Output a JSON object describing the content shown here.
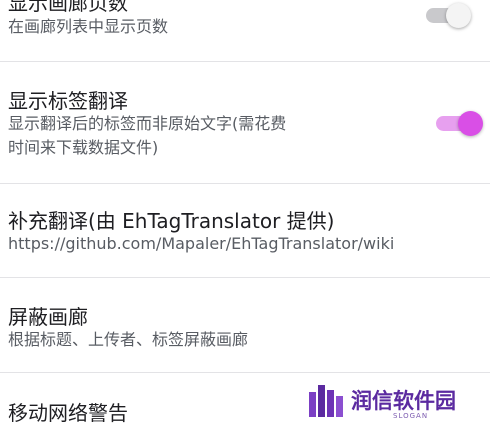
{
  "colors": {
    "accent": "#d94fe6",
    "accent_track": "#e7a0ef",
    "switch_off_track": "#c9c9cc",
    "divider": "#e3e3e6",
    "brand": "#5b2aa0"
  },
  "settings": [
    {
      "title": "显示画廊页数",
      "desc_lines": [
        "在画廊列表中显示页数"
      ],
      "toggle": {
        "on": false
      }
    },
    {
      "title": "显示标签翻译",
      "desc_lines": [
        "显示翻译后的标签而非原始文字(需花费",
        "时间来下载数据文件)"
      ],
      "toggle": {
        "on": true
      }
    },
    {
      "title": "补充翻译(由 EhTagTranslator 提供)",
      "desc_lines": [
        "https://github.com/Mapaler/EhTagTranslator/wiki"
      ]
    },
    {
      "title": "屏蔽画廊",
      "desc_lines": [
        "根据标题、上传者、标签屏蔽画廊"
      ]
    },
    {
      "title": "移动网络警告"
    }
  ],
  "watermark": {
    "name": "润信软件园",
    "slogan": "SLOGAN",
    "logo_icon": "bar-chart-logo-icon"
  }
}
